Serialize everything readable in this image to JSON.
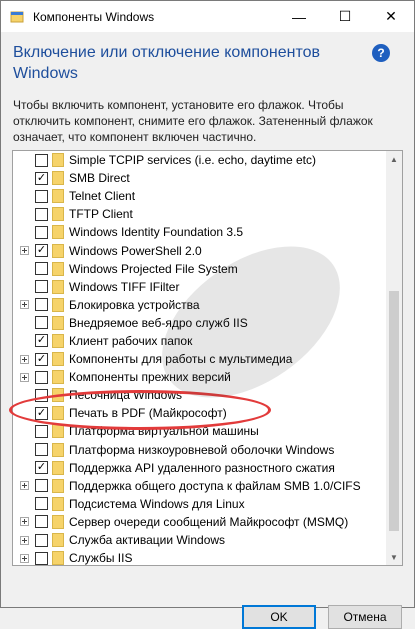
{
  "window": {
    "title": "Компоненты Windows",
    "controls": {
      "minimize": "—",
      "maximize": "☐",
      "close": "✕"
    }
  },
  "heading": "Включение или отключение компонентов Windows",
  "help_label": "?",
  "description": "Чтобы включить компонент, установите его флажок. Чтобы отключить компонент, снимите его флажок. Затененный флажок означает, что компонент включен частично.",
  "features": [
    {
      "label": "Simple TCPIP services (i.e. echo, daytime etc)",
      "expandable": false,
      "state": "unchecked"
    },
    {
      "label": "SMB Direct",
      "expandable": false,
      "state": "checked"
    },
    {
      "label": "Telnet Client",
      "expandable": false,
      "state": "unchecked"
    },
    {
      "label": "TFTP Client",
      "expandable": false,
      "state": "unchecked"
    },
    {
      "label": "Windows Identity Foundation 3.5",
      "expandable": false,
      "state": "unchecked"
    },
    {
      "label": "Windows PowerShell 2.0",
      "expandable": true,
      "state": "checked"
    },
    {
      "label": "Windows Projected File System",
      "expandable": false,
      "state": "unchecked"
    },
    {
      "label": "Windows TIFF IFilter",
      "expandable": false,
      "state": "unchecked"
    },
    {
      "label": "Блокировка устройства",
      "expandable": true,
      "state": "unchecked"
    },
    {
      "label": "Внедряемое веб-ядро служб IIS",
      "expandable": false,
      "state": "unchecked"
    },
    {
      "label": "Клиент рабочих папок",
      "expandable": false,
      "state": "checked"
    },
    {
      "label": "Компоненты для работы с мультимедиа",
      "expandable": true,
      "state": "checked"
    },
    {
      "label": "Компоненты прежних версий",
      "expandable": true,
      "state": "unchecked"
    },
    {
      "label": "Песочница Windows",
      "expandable": false,
      "state": "unchecked"
    },
    {
      "label": "Печать в PDF (Майкрософт)",
      "expandable": false,
      "state": "checked"
    },
    {
      "label": "Платформа виртуальной машины",
      "expandable": false,
      "state": "unchecked"
    },
    {
      "label": "Платформа низкоуровневой оболочки Windows",
      "expandable": false,
      "state": "unchecked"
    },
    {
      "label": "Поддержка API удаленного разностного сжатия",
      "expandable": false,
      "state": "checked"
    },
    {
      "label": "Поддержка общего доступа к файлам SMB 1.0/CIFS",
      "expandable": true,
      "state": "unchecked"
    },
    {
      "label": "Подсистема Windows для Linux",
      "expandable": false,
      "state": "unchecked"
    },
    {
      "label": "Сервер очереди сообщений Майкрософт (MSMQ)",
      "expandable": true,
      "state": "unchecked"
    },
    {
      "label": "Служба активации Windows",
      "expandable": true,
      "state": "unchecked"
    },
    {
      "label": "Службы IIS",
      "expandable": true,
      "state": "unchecked"
    }
  ],
  "buttons": {
    "ok": "OK",
    "cancel": "Отмена"
  },
  "colors": {
    "heading": "#1e4e9c",
    "highlight_ellipse": "#e23b3b",
    "ok_border": "#0078d7"
  }
}
